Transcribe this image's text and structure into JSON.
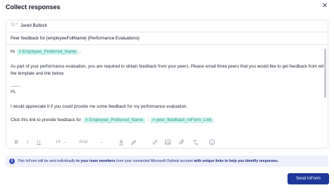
{
  "dialog": {
    "title": "Collect responses",
    "close_symbol": "✕"
  },
  "to": {
    "label": "To:*",
    "value": "Jared Bullock"
  },
  "subject": {
    "value": "Peer feedback for {employeeFullName} {Performance Evaluations}"
  },
  "body": {
    "greeting_prefix": "Hi",
    "greeting_tag": "# Employee_Preferred_Name",
    "greeting_suffix": ",",
    "paragraph_line1": "As part of your performance evaluation, you are required to obtain feedback from your peers. Please email three peers that you would like to get feedback from with",
    "paragraph_line2": "the template and link below.",
    "separator": "____",
    "hi_line": "Hi,",
    "request_line": "I would appreciate it if you could provide me some feedback for my performance evaluation.",
    "link_prefix": "Click this link to provide feedback for",
    "link_tag1": "# Employee_Preferred_Name",
    "link_colon": ":",
    "link_tag2": "# peer_feedback_InForm_Link"
  },
  "toolbar": {
    "bold_icon": "bold-icon",
    "italic_icon": "italic-icon",
    "underline_icon": "underline-icon",
    "font_size": "14",
    "font_family": "Arial",
    "text_color_icon": "text-color-icon",
    "highlight_icon": "highlight-icon",
    "link_icon": "link-icon",
    "image_icon": "image-icon",
    "attachment_icon": "attachment-icon",
    "clear_format_icon": "clear-format-icon",
    "emoji_icon": "emoji-icon"
  },
  "info": {
    "icon": "i",
    "text_part1": "This InForm will be sent individually ",
    "text_bold1": "to your team members",
    "text_part2": " from your connected Microsoft Outlook account ",
    "text_bold2": "with unique links to help you identify responses."
  },
  "actions": {
    "send_label": "Send InForm"
  },
  "colors": {
    "primary": "#1e3799",
    "tag_bg": "#d1f4ee",
    "tag_text": "#2c9c8c",
    "info_bg": "#eef0fb"
  }
}
